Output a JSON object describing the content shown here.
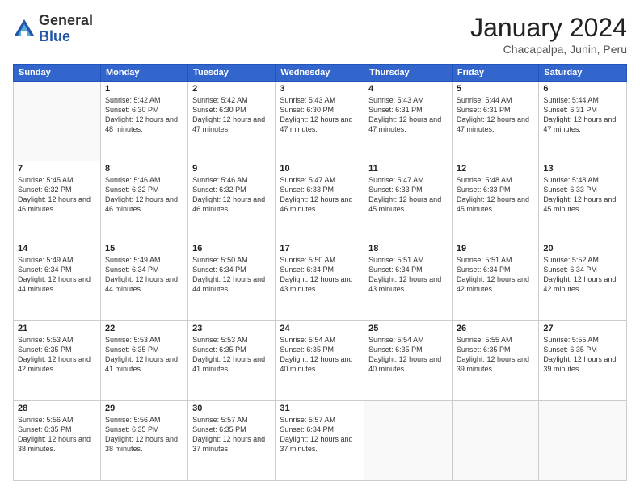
{
  "logo": {
    "general": "General",
    "blue": "Blue"
  },
  "header": {
    "month": "January 2024",
    "location": "Chacapalpa, Junin, Peru"
  },
  "days_of_week": [
    "Sunday",
    "Monday",
    "Tuesday",
    "Wednesday",
    "Thursday",
    "Friday",
    "Saturday"
  ],
  "weeks": [
    [
      {
        "day": "",
        "sunrise": "",
        "sunset": "",
        "daylight": ""
      },
      {
        "day": "1",
        "sunrise": "Sunrise: 5:42 AM",
        "sunset": "Sunset: 6:30 PM",
        "daylight": "Daylight: 12 hours and 48 minutes."
      },
      {
        "day": "2",
        "sunrise": "Sunrise: 5:42 AM",
        "sunset": "Sunset: 6:30 PM",
        "daylight": "Daylight: 12 hours and 47 minutes."
      },
      {
        "day": "3",
        "sunrise": "Sunrise: 5:43 AM",
        "sunset": "Sunset: 6:30 PM",
        "daylight": "Daylight: 12 hours and 47 minutes."
      },
      {
        "day": "4",
        "sunrise": "Sunrise: 5:43 AM",
        "sunset": "Sunset: 6:31 PM",
        "daylight": "Daylight: 12 hours and 47 minutes."
      },
      {
        "day": "5",
        "sunrise": "Sunrise: 5:44 AM",
        "sunset": "Sunset: 6:31 PM",
        "daylight": "Daylight: 12 hours and 47 minutes."
      },
      {
        "day": "6",
        "sunrise": "Sunrise: 5:44 AM",
        "sunset": "Sunset: 6:31 PM",
        "daylight": "Daylight: 12 hours and 47 minutes."
      }
    ],
    [
      {
        "day": "7",
        "sunrise": "Sunrise: 5:45 AM",
        "sunset": "Sunset: 6:32 PM",
        "daylight": "Daylight: 12 hours and 46 minutes."
      },
      {
        "day": "8",
        "sunrise": "Sunrise: 5:46 AM",
        "sunset": "Sunset: 6:32 PM",
        "daylight": "Daylight: 12 hours and 46 minutes."
      },
      {
        "day": "9",
        "sunrise": "Sunrise: 5:46 AM",
        "sunset": "Sunset: 6:32 PM",
        "daylight": "Daylight: 12 hours and 46 minutes."
      },
      {
        "day": "10",
        "sunrise": "Sunrise: 5:47 AM",
        "sunset": "Sunset: 6:33 PM",
        "daylight": "Daylight: 12 hours and 46 minutes."
      },
      {
        "day": "11",
        "sunrise": "Sunrise: 5:47 AM",
        "sunset": "Sunset: 6:33 PM",
        "daylight": "Daylight: 12 hours and 45 minutes."
      },
      {
        "day": "12",
        "sunrise": "Sunrise: 5:48 AM",
        "sunset": "Sunset: 6:33 PM",
        "daylight": "Daylight: 12 hours and 45 minutes."
      },
      {
        "day": "13",
        "sunrise": "Sunrise: 5:48 AM",
        "sunset": "Sunset: 6:33 PM",
        "daylight": "Daylight: 12 hours and 45 minutes."
      }
    ],
    [
      {
        "day": "14",
        "sunrise": "Sunrise: 5:49 AM",
        "sunset": "Sunset: 6:34 PM",
        "daylight": "Daylight: 12 hours and 44 minutes."
      },
      {
        "day": "15",
        "sunrise": "Sunrise: 5:49 AM",
        "sunset": "Sunset: 6:34 PM",
        "daylight": "Daylight: 12 hours and 44 minutes."
      },
      {
        "day": "16",
        "sunrise": "Sunrise: 5:50 AM",
        "sunset": "Sunset: 6:34 PM",
        "daylight": "Daylight: 12 hours and 44 minutes."
      },
      {
        "day": "17",
        "sunrise": "Sunrise: 5:50 AM",
        "sunset": "Sunset: 6:34 PM",
        "daylight": "Daylight: 12 hours and 43 minutes."
      },
      {
        "day": "18",
        "sunrise": "Sunrise: 5:51 AM",
        "sunset": "Sunset: 6:34 PM",
        "daylight": "Daylight: 12 hours and 43 minutes."
      },
      {
        "day": "19",
        "sunrise": "Sunrise: 5:51 AM",
        "sunset": "Sunset: 6:34 PM",
        "daylight": "Daylight: 12 hours and 42 minutes."
      },
      {
        "day": "20",
        "sunrise": "Sunrise: 5:52 AM",
        "sunset": "Sunset: 6:34 PM",
        "daylight": "Daylight: 12 hours and 42 minutes."
      }
    ],
    [
      {
        "day": "21",
        "sunrise": "Sunrise: 5:53 AM",
        "sunset": "Sunset: 6:35 PM",
        "daylight": "Daylight: 12 hours and 42 minutes."
      },
      {
        "day": "22",
        "sunrise": "Sunrise: 5:53 AM",
        "sunset": "Sunset: 6:35 PM",
        "daylight": "Daylight: 12 hours and 41 minutes."
      },
      {
        "day": "23",
        "sunrise": "Sunrise: 5:53 AM",
        "sunset": "Sunset: 6:35 PM",
        "daylight": "Daylight: 12 hours and 41 minutes."
      },
      {
        "day": "24",
        "sunrise": "Sunrise: 5:54 AM",
        "sunset": "Sunset: 6:35 PM",
        "daylight": "Daylight: 12 hours and 40 minutes."
      },
      {
        "day": "25",
        "sunrise": "Sunrise: 5:54 AM",
        "sunset": "Sunset: 6:35 PM",
        "daylight": "Daylight: 12 hours and 40 minutes."
      },
      {
        "day": "26",
        "sunrise": "Sunrise: 5:55 AM",
        "sunset": "Sunset: 6:35 PM",
        "daylight": "Daylight: 12 hours and 39 minutes."
      },
      {
        "day": "27",
        "sunrise": "Sunrise: 5:55 AM",
        "sunset": "Sunset: 6:35 PM",
        "daylight": "Daylight: 12 hours and 39 minutes."
      }
    ],
    [
      {
        "day": "28",
        "sunrise": "Sunrise: 5:56 AM",
        "sunset": "Sunset: 6:35 PM",
        "daylight": "Daylight: 12 hours and 38 minutes."
      },
      {
        "day": "29",
        "sunrise": "Sunrise: 5:56 AM",
        "sunset": "Sunset: 6:35 PM",
        "daylight": "Daylight: 12 hours and 38 minutes."
      },
      {
        "day": "30",
        "sunrise": "Sunrise: 5:57 AM",
        "sunset": "Sunset: 6:35 PM",
        "daylight": "Daylight: 12 hours and 37 minutes."
      },
      {
        "day": "31",
        "sunrise": "Sunrise: 5:57 AM",
        "sunset": "Sunset: 6:34 PM",
        "daylight": "Daylight: 12 hours and 37 minutes."
      },
      {
        "day": "",
        "sunrise": "",
        "sunset": "",
        "daylight": ""
      },
      {
        "day": "",
        "sunrise": "",
        "sunset": "",
        "daylight": ""
      },
      {
        "day": "",
        "sunrise": "",
        "sunset": "",
        "daylight": ""
      }
    ]
  ]
}
